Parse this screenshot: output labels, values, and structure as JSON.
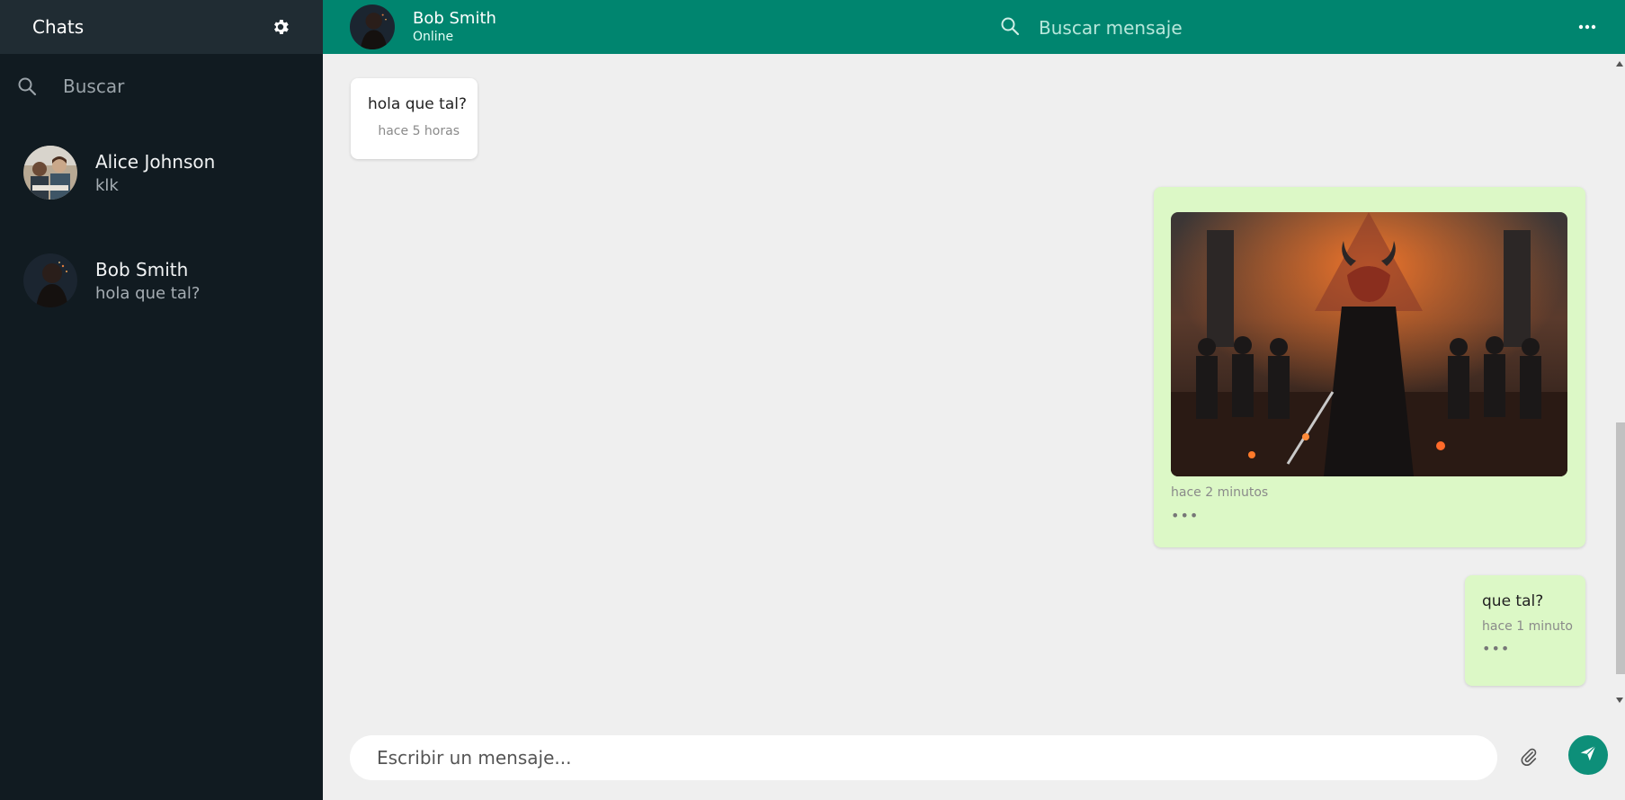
{
  "sidebar": {
    "title": "Chats",
    "search_placeholder": "Buscar",
    "chats": [
      {
        "name": "Alice Johnson",
        "last_message": "klk"
      },
      {
        "name": "Bob Smith",
        "last_message": "hola que tal?"
      }
    ]
  },
  "header": {
    "contact_name": "Bob Smith",
    "status": "Online",
    "search_placeholder": "Buscar mensaje"
  },
  "messages": [
    {
      "direction": "incoming",
      "text": "hola que tal?",
      "time": "hace 5 horas"
    },
    {
      "direction": "outgoing",
      "type": "image",
      "time": "hace 2 minutos",
      "menu": "•••"
    },
    {
      "direction": "outgoing",
      "text": "que tal?",
      "time": "hace 1 minuto",
      "menu": "•••"
    }
  ],
  "composer": {
    "placeholder": "Escribir un mensaje..."
  },
  "colors": {
    "header_green": "#00856f",
    "sidebar_bg": "#111b21",
    "outgoing_bubble": "#dcf8c6",
    "send_button": "#0d8f79"
  }
}
